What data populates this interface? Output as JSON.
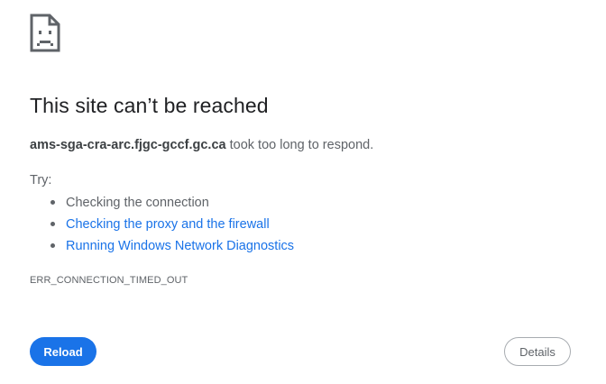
{
  "error": {
    "icon": "sad-document-icon",
    "title": "This site can’t be reached",
    "host": "ams-sga-cra-arc.fjgc-gccf.gc.ca",
    "message": " took too long to respond.",
    "try_label": "Try:",
    "suggestions": [
      {
        "label": "Checking the connection",
        "link": false
      },
      {
        "label": "Checking the proxy and the firewall",
        "link": true
      },
      {
        "label": "Running Windows Network Diagnostics",
        "link": true
      }
    ],
    "code": "ERR_CONNECTION_TIMED_OUT"
  },
  "buttons": {
    "reload_label": "Reload",
    "details_label": "Details"
  },
  "colors": {
    "accent": "#1a73e8",
    "text": "#5f6368",
    "title": "#202124"
  }
}
